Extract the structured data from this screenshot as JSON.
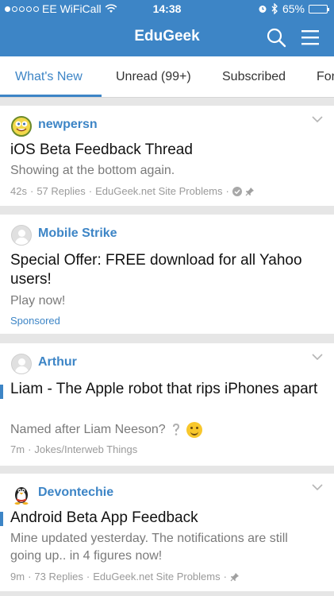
{
  "status_bar": {
    "carrier": "EE WiFiCall",
    "time": "14:38",
    "battery": "65%",
    "battery_level": 0.65
  },
  "header": {
    "title": "EduGeek"
  },
  "tabs": [
    {
      "label": "What's New",
      "active": true
    },
    {
      "label": "Unread (99+)",
      "active": false
    },
    {
      "label": "Subscribed",
      "active": false
    },
    {
      "label": "For",
      "active": false
    }
  ],
  "feed": [
    {
      "author": "newpersn",
      "avatar": "spongebob-avatar",
      "title": "iOS Beta Feedback Thread",
      "snippet": "Showing at the bottom again.",
      "age": "42s",
      "replies": "57 Replies",
      "forum": "EduGeek.net Site Problems",
      "unread": false
    },
    {
      "author": "Mobile Strike",
      "avatar": "default-avatar",
      "title": "Special Offer: FREE download for all Yahoo users!",
      "snippet": "Play now!",
      "sponsored": "Sponsored"
    },
    {
      "author": "Arthur",
      "avatar": "default-avatar",
      "title": "Liam - The Apple robot that rips iPhones apart",
      "snippet": "Named after Liam Neeson?",
      "age": "7m",
      "forum": "Jokes/Interweb Things",
      "unread": true
    },
    {
      "author": "Devontechie",
      "avatar": "tux-avatar",
      "title": "Android Beta App Feedback",
      "snippet": "Mine updated yesterday. The notifications are still going up.. in 4 figures now!",
      "age": "9m",
      "replies": "73 Replies",
      "forum": "EduGeek.net Site Problems",
      "unread": true
    }
  ],
  "meta_separator": "·",
  "colors": {
    "brand": "#3d85c6",
    "background": "#e6e6e6"
  }
}
